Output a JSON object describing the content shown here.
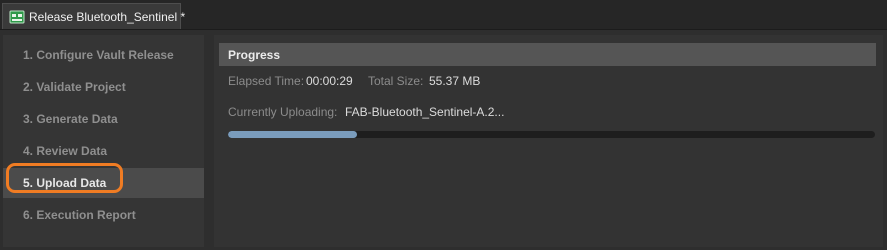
{
  "tab": {
    "title": "Release Bluetooth_Sentinel *",
    "icon": "schematic-doc-icon"
  },
  "steps": [
    {
      "label": "1. Configure Vault Release"
    },
    {
      "label": "2. Validate Project"
    },
    {
      "label": "3. Generate Data"
    },
    {
      "label": "4. Review Data"
    },
    {
      "label": "5. Upload Data"
    },
    {
      "label": "6. Execution Report"
    }
  ],
  "active_step": "5. Upload Data",
  "progress": {
    "header": "Progress",
    "elapsed_label": "Elapsed Time:",
    "elapsed_value": "00:00:29",
    "size_label": "Total Size:",
    "size_value": "55.37 MB",
    "uploading_label": "Currently Uploading:",
    "uploading_value": "FAB-Bluetooth_Sentinel-A.2...",
    "fraction": 0.2
  },
  "colors": {
    "highlight": "#f07c23",
    "progress_fill": "#7a9cbc"
  }
}
